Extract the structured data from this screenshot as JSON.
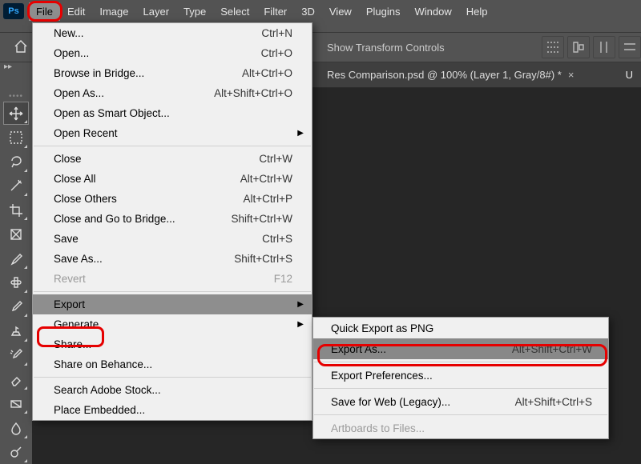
{
  "app_badge": "Ps",
  "menubar": [
    "File",
    "Edit",
    "Image",
    "Layer",
    "Type",
    "Select",
    "Filter",
    "3D",
    "View",
    "Plugins",
    "Window",
    "Help"
  ],
  "options": {
    "label_fragment": "Show Transform Controls"
  },
  "tab": {
    "title": "Res Comparison.psd @ 100% (Layer 1, Gray/8#) *",
    "right_char": "U"
  },
  "file_menu": {
    "group1": [
      {
        "label": "New...",
        "shortcut": "Ctrl+N"
      },
      {
        "label": "Open...",
        "shortcut": "Ctrl+O"
      },
      {
        "label": "Browse in Bridge...",
        "shortcut": "Alt+Ctrl+O"
      },
      {
        "label": "Open As...",
        "shortcut": "Alt+Shift+Ctrl+O"
      },
      {
        "label": "Open as Smart Object..."
      },
      {
        "label": "Open Recent",
        "submenu": true
      }
    ],
    "group2": [
      {
        "label": "Close",
        "shortcut": "Ctrl+W"
      },
      {
        "label": "Close All",
        "shortcut": "Alt+Ctrl+W"
      },
      {
        "label": "Close Others",
        "shortcut": "Alt+Ctrl+P"
      },
      {
        "label": "Close and Go to Bridge...",
        "shortcut": "Shift+Ctrl+W"
      },
      {
        "label": "Save",
        "shortcut": "Ctrl+S"
      },
      {
        "label": "Save As...",
        "shortcut": "Shift+Ctrl+S"
      },
      {
        "label": "Revert",
        "shortcut": "F12",
        "disabled": true
      }
    ],
    "group3": [
      {
        "label": "Export",
        "submenu": true,
        "hover": true
      },
      {
        "label": "Generate",
        "submenu": true
      },
      {
        "label": "Share..."
      },
      {
        "label": "Share on Behance..."
      }
    ],
    "group4": [
      {
        "label": "Search Adobe Stock..."
      },
      {
        "label": "Place Embedded..."
      }
    ]
  },
  "export_menu": {
    "g1": [
      {
        "label": "Quick Export as PNG"
      },
      {
        "label": "Export As...",
        "shortcut": "Alt+Shift+Ctrl+W",
        "hover": true
      }
    ],
    "g2": [
      {
        "label": "Export Preferences..."
      }
    ],
    "g3": [
      {
        "label": "Save for Web (Legacy)...",
        "shortcut": "Alt+Shift+Ctrl+S"
      }
    ],
    "g4": [
      {
        "label": "Artboards to Files...",
        "disabled": true
      }
    ]
  },
  "tools": [
    {
      "name": "move-tool",
      "selected": true
    },
    {
      "name": "marquee-tool"
    },
    {
      "name": "lasso-tool"
    },
    {
      "name": "magic-wand-tool"
    },
    {
      "name": "crop-tool"
    },
    {
      "name": "frame-tool"
    },
    {
      "name": "eyedropper-tool"
    },
    {
      "name": "healing-brush-tool"
    },
    {
      "name": "brush-tool"
    },
    {
      "name": "clone-stamp-tool"
    },
    {
      "name": "history-brush-tool"
    },
    {
      "name": "eraser-tool"
    },
    {
      "name": "gradient-tool"
    },
    {
      "name": "blur-tool"
    },
    {
      "name": "dodge-tool"
    }
  ]
}
